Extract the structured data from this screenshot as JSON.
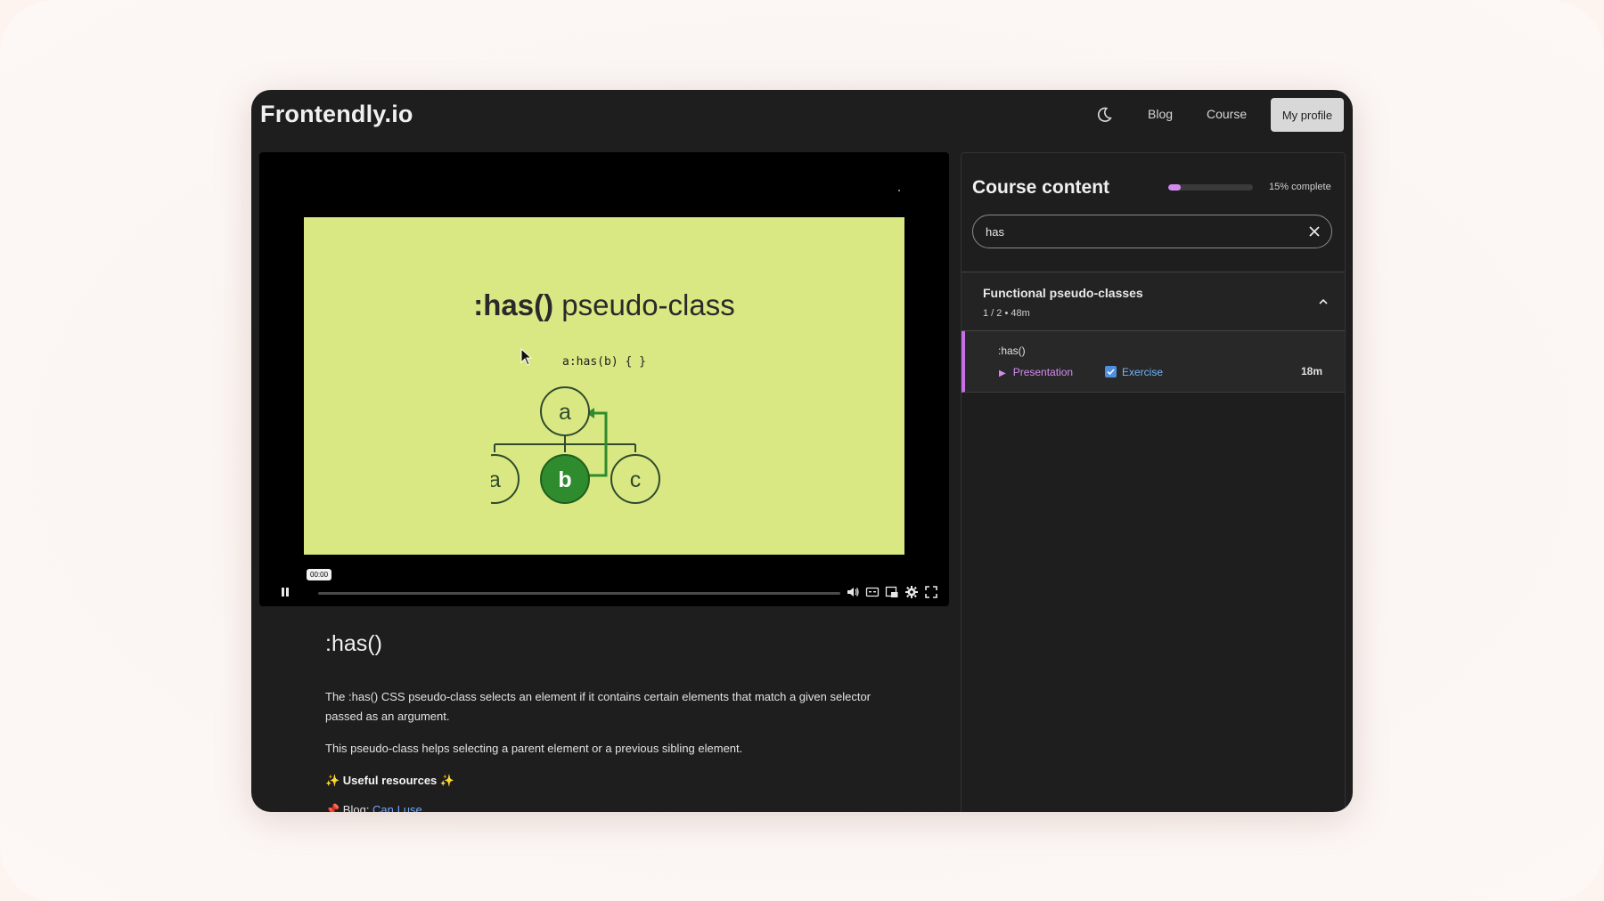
{
  "header": {
    "logo": "Frontendly.io",
    "nav": {
      "blog": "Blog",
      "course": "Course"
    },
    "profile_button": "My profile",
    "theme_icon": "moon-icon"
  },
  "video": {
    "slide_title_bold": ":has()",
    "slide_title_rest": " pseudo-class",
    "slide_code": "a:has(b) { }",
    "tree_nodes": {
      "root": "a",
      "left": "a",
      "middle": "b",
      "right": "c"
    },
    "time_badge": "00:00",
    "slide_bg": "#d9e882",
    "highlight_node_color": "#2e8b2e"
  },
  "description": {
    "title": ":has()",
    "paragraph1": "The :has() CSS pseudo-class selects an element if it contains certain elements that match a given selector passed as an argument.",
    "paragraph2": "This pseudo-class helps selecting a parent element or a previous sibling element.",
    "resources_heading": "✨ Useful resources ✨",
    "more_prefix": "📌 Blog: ",
    "more_link": "Can I use"
  },
  "sidebar": {
    "title": "Course content",
    "progress_fraction": 0.15,
    "progress_text": "15% complete",
    "search": {
      "value": "has",
      "placeholder": ""
    },
    "section": {
      "title": "Functional pseudo-classes",
      "meta": "1 / 2  •  48m"
    },
    "lesson": {
      "title": ":has()",
      "presentation": "Presentation",
      "exercise": "Exercise",
      "duration": "18m"
    },
    "accent": "#d48bf0"
  }
}
